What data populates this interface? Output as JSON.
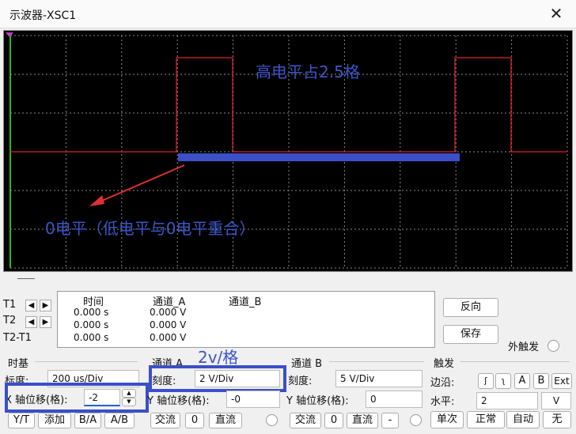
{
  "window": {
    "title": "示波器-XSC1",
    "close_glyph": "✕"
  },
  "annotations": {
    "high_level": "高电平占2.5格",
    "zero_level": "0电平（低电平与0电平重合）",
    "scale_note": "2v/格"
  },
  "cursors": {
    "t1": "T1",
    "t2": "T2",
    "t2t1": "T2-T1"
  },
  "readout": {
    "headers": [
      "时间",
      "通道_A",
      "通道_B"
    ],
    "rows": [
      {
        "time": "0.000 s",
        "cha": "0.000 V"
      },
      {
        "time": "0.000 s",
        "cha": "0.000 V"
      },
      {
        "time": "0.000 s",
        "cha": "0.000 V"
      }
    ]
  },
  "buttons": {
    "reverse": "反向",
    "save": "保存",
    "ext_trigger": "外触发"
  },
  "timebase": {
    "title": "时基",
    "scale_label": "标度:",
    "scale_value": "200 us/Div",
    "xpos_label": "X 轴位移(格):",
    "xpos_value": "-2",
    "modes": [
      "Y/T",
      "添加",
      "B/A",
      "A/B"
    ]
  },
  "channel_a": {
    "title": "通道 A",
    "scale_label": "刻度:",
    "scale_value": "2  V/Div",
    "ypos_label": "Y 轴位移(格):",
    "ypos_value": "-0",
    "coupling": [
      "交流",
      "0",
      "直流"
    ]
  },
  "channel_b": {
    "title": "通道 B",
    "scale_label": "刻度:",
    "scale_value": "5  V/Div",
    "ypos_label": "Y 轴位移(格):",
    "ypos_value": "0",
    "coupling": [
      "交流",
      "0",
      "直流",
      "-"
    ]
  },
  "trigger": {
    "title": "触发",
    "edge_label": "边沿:",
    "edge_buttons": [
      "A",
      "B",
      "Ext"
    ],
    "level_label": "水平:",
    "level_value": "2",
    "level_unit": "V",
    "modes": [
      "单次",
      "正常",
      "自动",
      "无"
    ]
  },
  "colors": {
    "screen_bg": "#000000",
    "grid": "#9a9a9a",
    "trace": "#e0202a",
    "annotation": "#3c55c8",
    "left_axis": "#20c020"
  }
}
